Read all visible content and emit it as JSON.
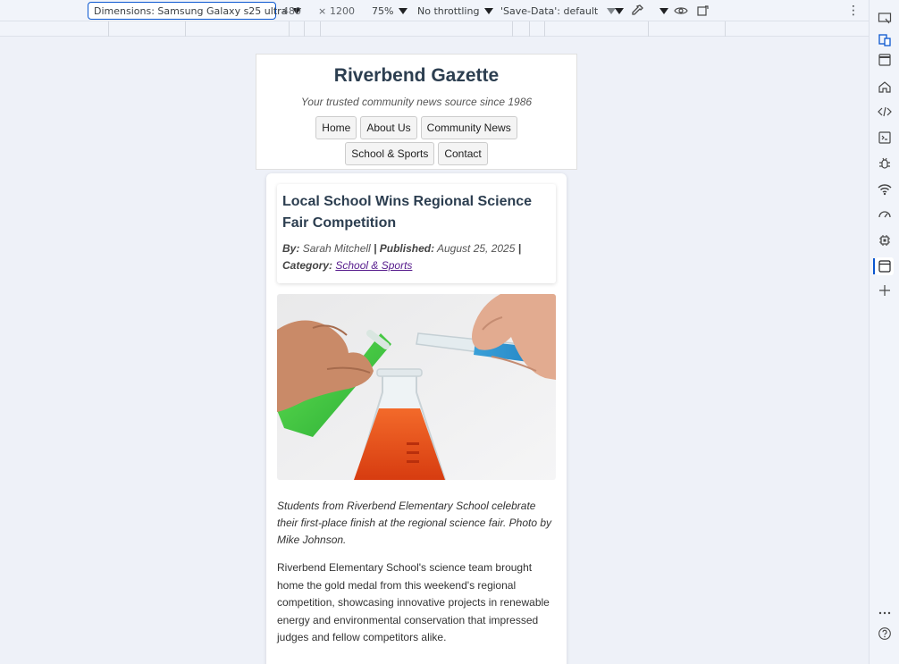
{
  "devtools": {
    "device_label": "Dimensions: Samsung Galaxy s25 ultra",
    "width": "480",
    "times": "×",
    "height": "1200",
    "zoom": "75%",
    "throttling": "No throttling",
    "save_data": "'Save-Data': default",
    "more_label": "⋮"
  },
  "rail_icons": [
    "device-toolbar-icon",
    "inspect-icon",
    "window-icon",
    "home-icon",
    "code-icon",
    "console-icon",
    "bug-icon",
    "wifi-icon",
    "performance-icon",
    "chip-icon",
    "browser-tab-icon",
    "add-icon",
    "more-icon",
    "help-icon"
  ],
  "site": {
    "title": "Riverbend Gazette",
    "tagline": "Your trusted community news source since 1986",
    "nav": [
      "Home",
      "About Us",
      "Community News",
      "School & Sports",
      "Contact"
    ]
  },
  "article": {
    "headline": "Local School Wins Regional Science Fair Competition",
    "by_label": "By:",
    "author": "Sarah Mitchell",
    "sep": "|",
    "published_label": "Published:",
    "date": "August 25, 2025",
    "category_label": "Category:",
    "category": "School & Sports",
    "photo_alt": "Hands pouring colored liquids between glass lab flasks",
    "caption": "Students from Riverbend Elementary School celebrate their first-place finish at the regional science fair. Photo by Mike Johnson.",
    "body": "Riverbend Elementary School's science team brought home the gold medal from this weekend's regional competition, showcasing innovative projects in renewable energy and environmental conservation that impressed judges and fellow competitors alike."
  },
  "colors": {
    "title": "#2c3e50",
    "link_visited": "#551a8b",
    "accent": "#0b57d0"
  }
}
